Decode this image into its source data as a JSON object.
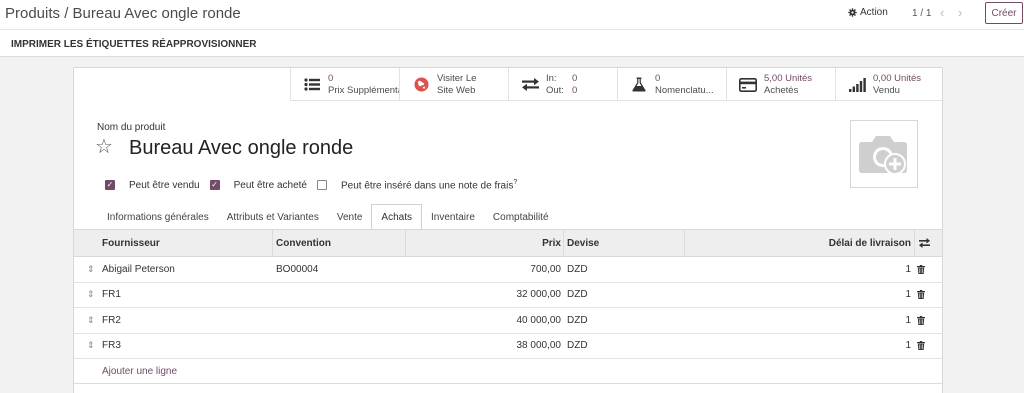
{
  "breadcrumb": {
    "parent": "Produits",
    "separator": " / ",
    "current": "Bureau Avec ongle ronde"
  },
  "control": {
    "action_label": "Action",
    "pager": "1 / 1",
    "create_label": "Créer"
  },
  "header_buttons": [
    "IMPRIMER LES ÉTIQUETTES",
    "RÉAPPROVISIONNER"
  ],
  "smart_buttons": [
    {
      "icon": "list-icon",
      "value": "0",
      "label": "Prix Supplémentaires"
    },
    {
      "icon": "globe-icon",
      "value": "Visiter Le",
      "label": "Site Web"
    },
    {
      "icon": "exchange-icon",
      "in_label": "In:",
      "in_value": "0",
      "out_label": "Out:",
      "out_value": "0"
    },
    {
      "icon": "flask-icon",
      "value": "0",
      "label": "Nomenclatu..."
    },
    {
      "icon": "credit-card-icon",
      "value": "5,00 Unités",
      "label": "Achetés"
    },
    {
      "icon": "signal-icon",
      "value": "0,00 Unités",
      "label": "Vendu"
    }
  ],
  "product": {
    "name_label": "Nom du produit",
    "name": "Bureau Avec ongle ronde"
  },
  "checkboxes": [
    {
      "label": "Peut être vendu",
      "checked": true
    },
    {
      "label": "Peut être acheté",
      "checked": true
    },
    {
      "label": "Peut être inséré dans une note de frais",
      "checked": false,
      "tooltip_mark": "?"
    }
  ],
  "tabs": [
    "Informations générales",
    "Attributs et Variantes",
    "Vente",
    "Achats",
    "Inventaire",
    "Comptabilité"
  ],
  "active_tab": "Achats",
  "table": {
    "headers": {
      "vendor": "Fournisseur",
      "contract": "Convention",
      "price": "Prix",
      "currency": "Devise",
      "delay": "Délai de livraison"
    },
    "rows": [
      {
        "vendor": "Abigail Peterson",
        "contract": "BO00004",
        "price": "700,00",
        "currency": "DZD",
        "delay": "1"
      },
      {
        "vendor": "FR1",
        "contract": "",
        "price": "32 000,00",
        "currency": "DZD",
        "delay": "1"
      },
      {
        "vendor": "FR2",
        "contract": "",
        "price": "40 000,00",
        "currency": "DZD",
        "delay": "1"
      },
      {
        "vendor": "FR3",
        "contract": "",
        "price": "38 000,00",
        "currency": "DZD",
        "delay": "1"
      }
    ],
    "add_line": "Ajouter une ligne"
  },
  "colors": {
    "brand": "#714b67",
    "globe": "#d9534f"
  }
}
